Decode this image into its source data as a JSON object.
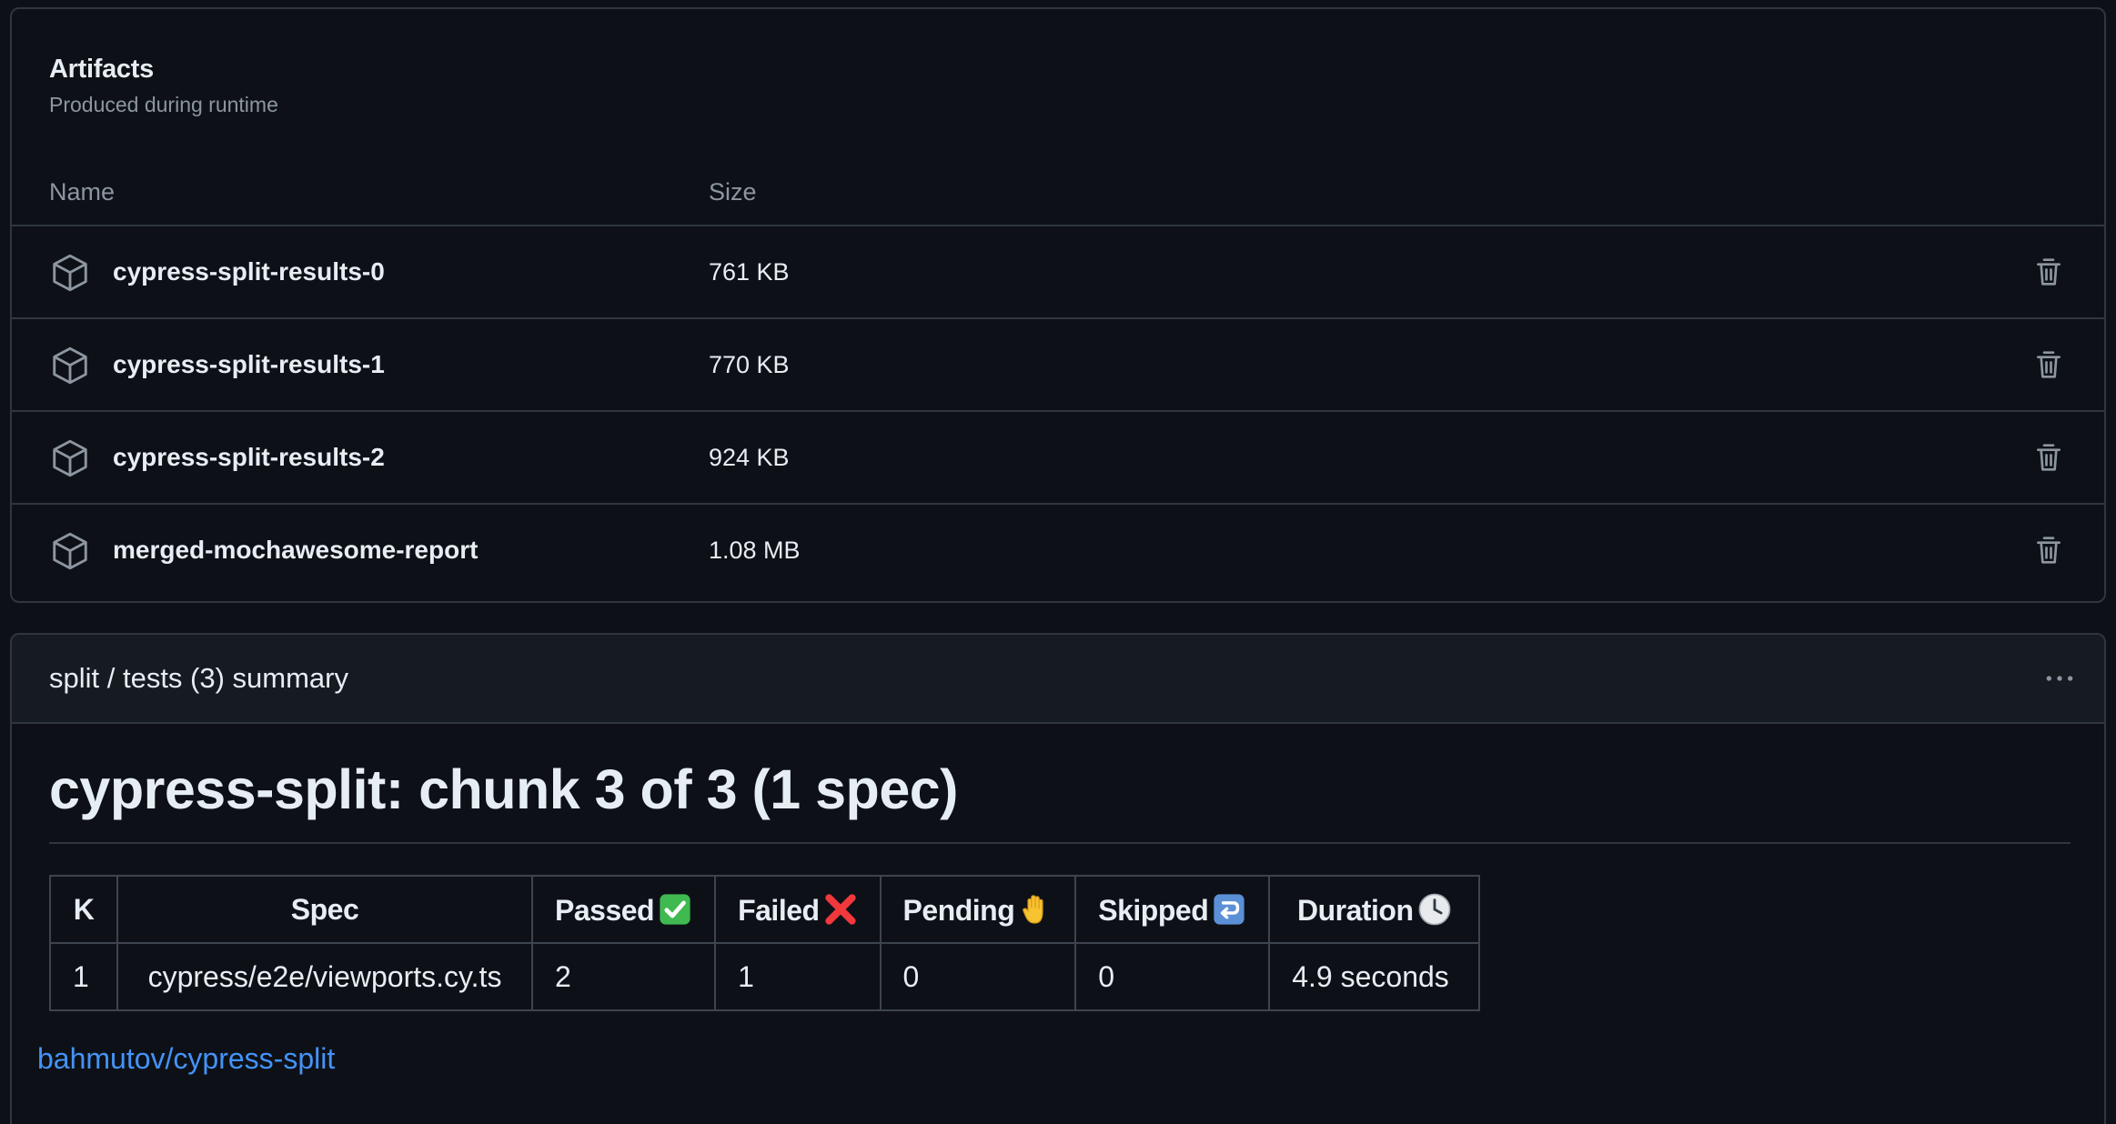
{
  "artifacts": {
    "title": "Artifacts",
    "subtitle": "Produced during runtime",
    "columns": {
      "name": "Name",
      "size": "Size"
    },
    "items": [
      {
        "name": "cypress-split-results-0",
        "size": "761 KB"
      },
      {
        "name": "cypress-split-results-1",
        "size": "770 KB"
      },
      {
        "name": "cypress-split-results-2",
        "size": "924 KB"
      },
      {
        "name": "merged-mochawesome-report",
        "size": "1.08 MB"
      }
    ]
  },
  "summary": {
    "title": "split / tests (3) summary",
    "heading": "cypress-split: chunk 3 of 3 (1 spec)",
    "table": {
      "headers": {
        "k": "K",
        "spec": "Spec",
        "passed": "Passed",
        "failed": "Failed",
        "pending": "Pending",
        "skipped": "Skipped",
        "duration": "Duration"
      },
      "rows": [
        {
          "k": "1",
          "spec": "cypress/e2e/viewports.cy.ts",
          "passed": "2",
          "failed": "1",
          "pending": "0",
          "skipped": "0",
          "duration": "4.9 seconds"
        }
      ]
    },
    "link": "bahmutov/cypress-split"
  },
  "colors": {
    "background": "#0d1117",
    "header_bg": "#161b22",
    "border": "#30363d",
    "text": "#e6edf3",
    "muted": "#8d96a0",
    "link": "#4493f8"
  },
  "icons": {
    "artifact": "package-icon",
    "delete": "trash-icon",
    "menu": "kebab-horizontal-icon",
    "passed": "check-mark-button-emoji",
    "failed": "cross-mark-emoji",
    "pending": "raised-hand-emoji",
    "skipped": "return-arrow-emoji",
    "duration": "clock-emoji"
  }
}
